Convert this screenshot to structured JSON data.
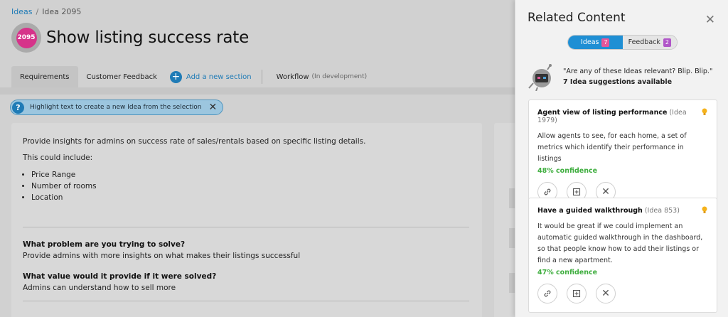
{
  "breadcrumb": {
    "root": "Ideas",
    "current": "Idea 2095"
  },
  "idea": {
    "badge": "2095",
    "title": "Show listing success rate"
  },
  "tabs": [
    {
      "label": "Requirements"
    },
    {
      "label": "Customer Feedback"
    }
  ],
  "add_section_label": "Add a new section",
  "workflow": {
    "label": "Workflow",
    "note": "(In development)"
  },
  "hint": {
    "text": "Highlight text to create a new Idea from the selection"
  },
  "content": {
    "intro": "Provide insights for admins on success rate of sales/rentals based on specific listing details.",
    "lead": "This could include:",
    "bullets": [
      "Price Range",
      "Number of rooms",
      "Location"
    ],
    "q1": "What problem are you trying to solve?",
    "a1": "Provide admins with more insights on what makes their listings successful",
    "q2": "What value would it provide if it were solved?",
    "a2": "Admins can understand how to sell more"
  },
  "drawer": {
    "title": "Related Content",
    "toggle": {
      "ideas_label": "Ideas",
      "ideas_count": "7",
      "feedback_label": "Feedback",
      "feedback_count": "2"
    },
    "bot_message": "\"Are any of these Ideas relevant? Blip. Blip.\"",
    "bot_sub": "7 Idea suggestions available",
    "cards": [
      {
        "title": "Agent view of listing performance",
        "id": "(Idea 1979)",
        "desc": "Allow agents to see, for each home, a set of metrics which identify their performance in listings",
        "confidence": "48% confidence"
      },
      {
        "title": "Have a guided walkthrough",
        "id": "(Idea 853)",
        "desc": "It would be great if we could implement an automatic guided walkthrough in the dashboard, so that people know how to add their listings or find a new apartment.",
        "confidence": "47% confidence"
      }
    ]
  },
  "colors": {
    "accent": "#1f8fd4",
    "confidence": "#3fae3f",
    "badge": "#d6338a"
  }
}
